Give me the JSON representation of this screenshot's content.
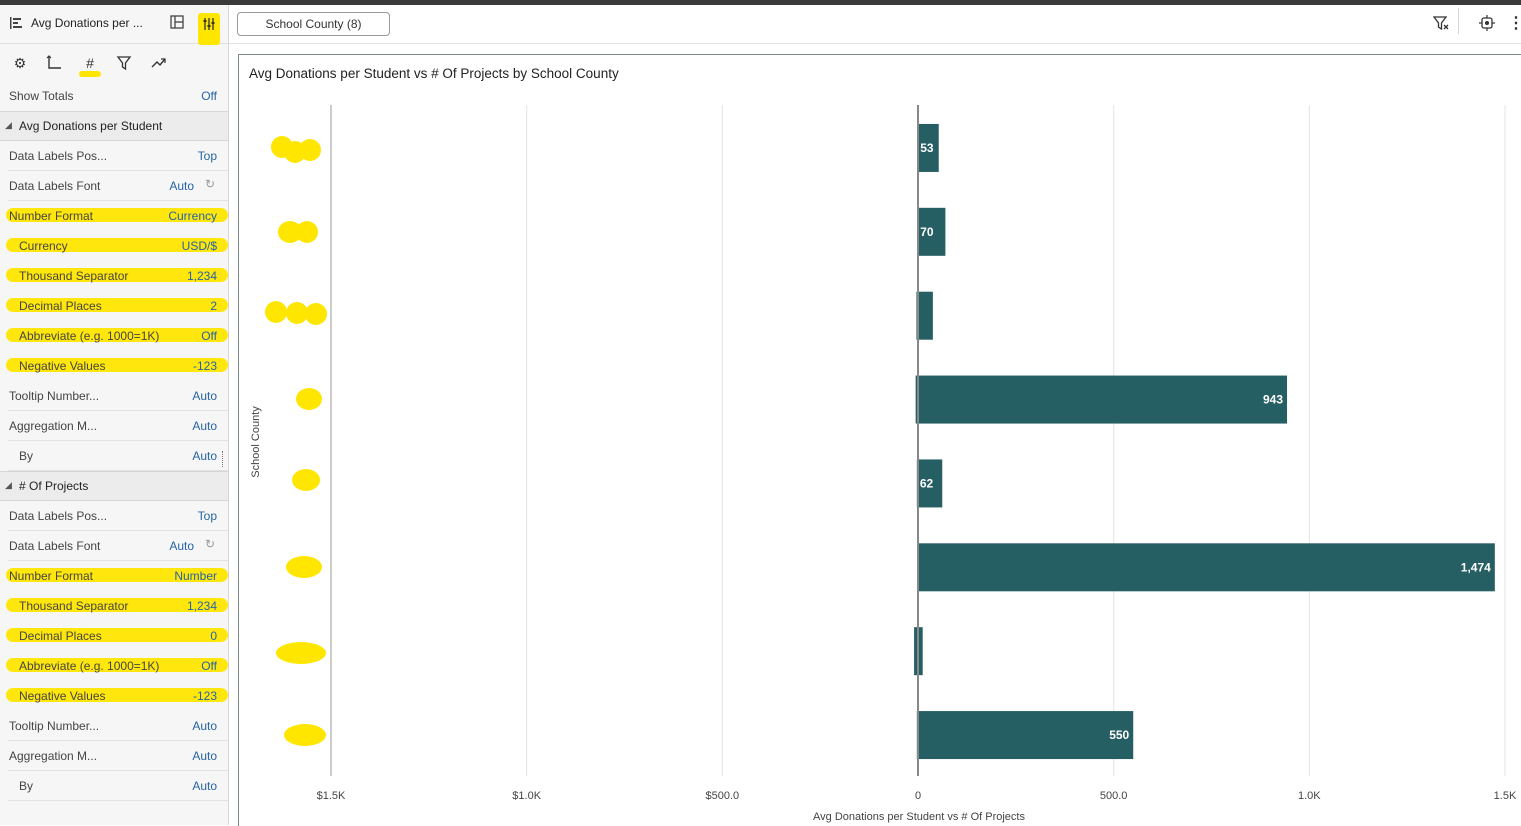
{
  "panel": {
    "title": "Avg Donations per ...",
    "tools": [
      "settings",
      "axis",
      "number",
      "filter",
      "trend"
    ],
    "show_totals": {
      "label": "Show Totals",
      "value": "Off"
    },
    "sections": [
      {
        "title": "Avg Donations per Student",
        "rows": [
          {
            "label": "Data Labels Pos...",
            "value": "Top"
          },
          {
            "label": "Data Labels Font",
            "value": "Auto",
            "reset": true
          },
          {
            "label": "Number Format",
            "value": "Currency",
            "highlighted": true
          },
          {
            "label": "Currency",
            "value": "USD/$",
            "indent": true,
            "highlighted": true
          },
          {
            "label": "Thousand Separator",
            "value": "1,234",
            "indent": true,
            "highlighted": true
          },
          {
            "label": "Decimal Places",
            "value": "2",
            "indent": true,
            "highlighted": true
          },
          {
            "label": "Abbreviate (e.g. 1000=1K)",
            "value": "Off",
            "indent": true,
            "highlighted": true
          },
          {
            "label": "Negative Values",
            "value": "-123",
            "indent": true,
            "highlighted": true
          },
          {
            "label": "Tooltip Number...",
            "value": "Auto"
          },
          {
            "label": "Aggregation M...",
            "value": "Auto"
          },
          {
            "label": "By",
            "value": "Auto",
            "indent": true
          }
        ]
      },
      {
        "title": "# Of Projects",
        "rows": [
          {
            "label": "Data Labels Pos...",
            "value": "Top"
          },
          {
            "label": "Data Labels Font",
            "value": "Auto",
            "reset": true
          },
          {
            "label": "Number Format",
            "value": "Number",
            "highlighted": true
          },
          {
            "label": "Thousand Separator",
            "value": "1,234",
            "indent": true,
            "highlighted": true
          },
          {
            "label": "Decimal Places",
            "value": "0",
            "indent": true,
            "highlighted": true
          },
          {
            "label": "Abbreviate (e.g. 1000=1K)",
            "value": "Off",
            "indent": true,
            "highlighted": true
          },
          {
            "label": "Negative Values",
            "value": "-123",
            "indent": true,
            "highlighted": true
          },
          {
            "label": "Tooltip Number...",
            "value": "Auto"
          },
          {
            "label": "Aggregation M...",
            "value": "Auto"
          },
          {
            "label": "By",
            "value": "Auto",
            "indent": true
          }
        ]
      }
    ]
  },
  "filter_chip": "School County (8)",
  "chart_data": {
    "type": "bar",
    "orientation": "horizontal",
    "title": "Avg Donations per Student vs # Of Projects by School County",
    "xlabel": "Avg Donations per Student vs # Of Projects",
    "ylabel": "School County",
    "bar_color": "#255e63",
    "left_ticks": [
      "$1.5K",
      "$1.0K",
      "$500.0",
      "0"
    ],
    "right_ticks": [
      "500.0",
      "1.0K",
      "1.5K"
    ],
    "series": [
      {
        "name": "# Of Projects",
        "values": [
          53,
          70,
          38,
          943,
          62,
          1474,
          12,
          550
        ]
      },
      {
        "name": "Avg Donations per Student",
        "values": [
          2,
          2,
          4,
          6,
          3,
          2,
          10,
          3
        ]
      }
    ],
    "data_labels": [
      "53",
      "70",
      "",
      "943",
      "62",
      "1,474",
      "",
      "550"
    ],
    "xlim_left": [
      0,
      1500
    ],
    "xlim_right": [
      0,
      1500
    ],
    "grid": true
  }
}
